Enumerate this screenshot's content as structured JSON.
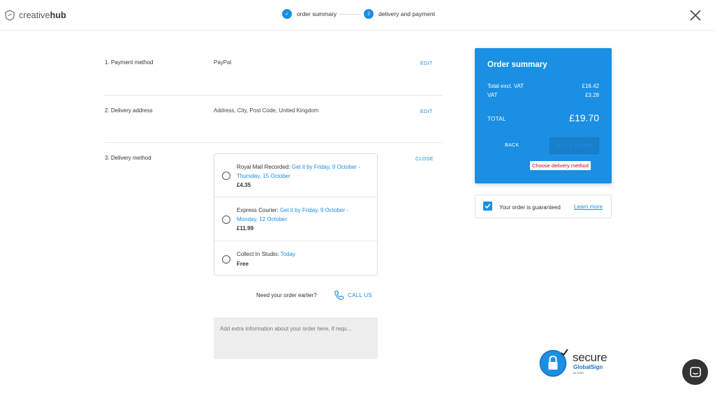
{
  "header": {
    "logo_prefix": "creative",
    "logo_bold": "hub",
    "steps": [
      {
        "label": "order summary",
        "marker": "✓"
      },
      {
        "label": "delivery and payment",
        "marker": "2"
      }
    ]
  },
  "sections": {
    "payment": {
      "label": "1. Payment method",
      "value": "PayPal",
      "action": "EDIT"
    },
    "address": {
      "label": "2. Delivery address",
      "value": "Address, City, Post Code, United Kingdom",
      "action": "EDIT"
    },
    "delivery": {
      "label": "3. Delivery method",
      "action": "CLOSE"
    }
  },
  "delivery_options": [
    {
      "name": "Royal Mail Recorded:",
      "eta": "Get it by Friday, 9 October - Thursday, 15 October",
      "price": "£4.35"
    },
    {
      "name": "Express Courier:",
      "eta": "Get it by Friday, 9 October - Monday, 12 October",
      "price": "£11.99"
    },
    {
      "name": "Collect In Studio:",
      "eta": "Today",
      "price": "Free"
    }
  ],
  "help": {
    "text": "Need your order earlier?",
    "call": "CALL US"
  },
  "notes": {
    "placeholder": "Add extra information about your order here, if requ..."
  },
  "summary": {
    "title": "Order summary",
    "excl_label": "Total excl. VAT",
    "excl_value": "£16.42",
    "vat_label": "VAT",
    "vat_value": "£3.28",
    "total_label": "TOTAL",
    "total_value": "£19.70",
    "back": "BACK",
    "place": "PLACE ORDER",
    "hint": "Choose delivery method"
  },
  "guarantee": {
    "text": "Your order is guaranteed",
    "link": "Learn more"
  },
  "badge": {
    "title": "secure",
    "sub": "GlobalSign",
    "by": "by GMO"
  },
  "colors": {
    "accent": "#1a8fe3",
    "error": "#d0021b",
    "chat": "#333333"
  },
  "icons": [
    "logo-shield-icon",
    "check-icon",
    "close-icon",
    "phone-icon",
    "padlock-icon",
    "chat-icon"
  ]
}
